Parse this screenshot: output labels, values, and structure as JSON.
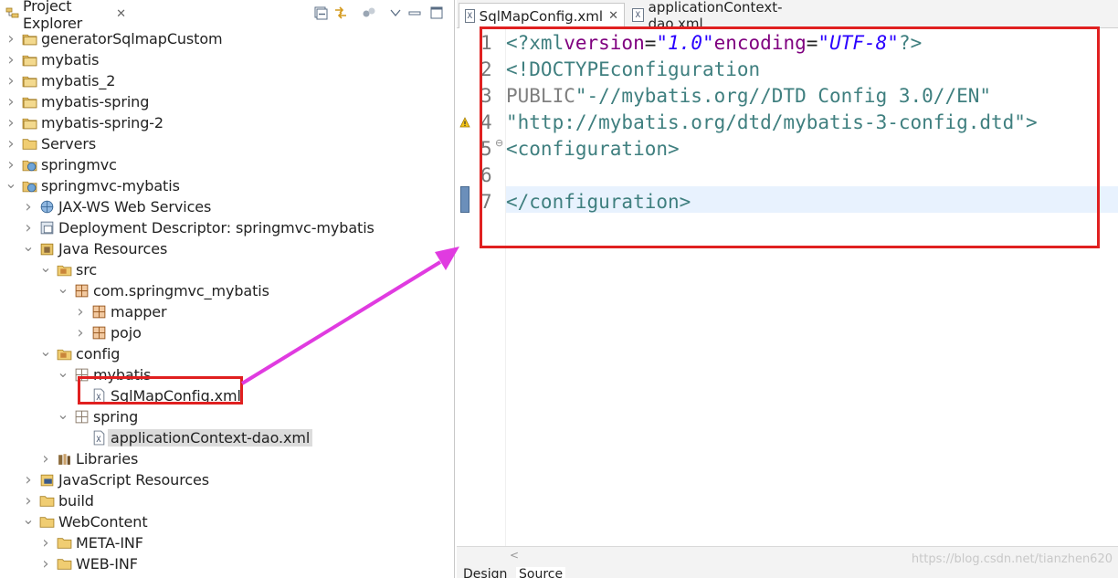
{
  "explorer": {
    "title": "Project Explorer",
    "close_icon": "close-icon",
    "toolbar": [
      "collapse-all-icon",
      "link-editor-icon",
      "focus-icon",
      "view-menu-icon",
      "minimize-icon",
      "maximize-icon"
    ]
  },
  "tree": [
    {
      "label": "generatorSqlmapCustom",
      "depth": 0,
      "chevron": "right",
      "icon": "project-icon"
    },
    {
      "label": "mybatis",
      "depth": 0,
      "chevron": "right",
      "icon": "project-icon"
    },
    {
      "label": "mybatis_2",
      "depth": 0,
      "chevron": "right",
      "icon": "project-icon"
    },
    {
      "label": "mybatis-spring",
      "depth": 0,
      "chevron": "right",
      "icon": "project-icon"
    },
    {
      "label": "mybatis-spring-2",
      "depth": 0,
      "chevron": "right",
      "icon": "project-icon"
    },
    {
      "label": "Servers",
      "depth": 0,
      "chevron": "right",
      "icon": "folder-icon"
    },
    {
      "label": "springmvc",
      "depth": 0,
      "chevron": "right",
      "icon": "web-project-icon"
    },
    {
      "label": "springmvc-mybatis",
      "depth": 0,
      "chevron": "down",
      "icon": "web-project-icon"
    },
    {
      "label": "JAX-WS Web Services",
      "depth": 1,
      "chevron": "right",
      "icon": "web-services-icon"
    },
    {
      "label": "Deployment Descriptor: springmvc-mybatis",
      "depth": 1,
      "chevron": "right",
      "icon": "descriptor-icon"
    },
    {
      "label": "Java Resources",
      "depth": 1,
      "chevron": "down",
      "icon": "java-resources-icon"
    },
    {
      "label": "src",
      "depth": 2,
      "chevron": "down",
      "icon": "source-folder-icon"
    },
    {
      "label": "com.springmvc_mybatis",
      "depth": 3,
      "chevron": "down",
      "icon": "package-icon"
    },
    {
      "label": "mapper",
      "depth": 4,
      "chevron": "right",
      "icon": "package-icon"
    },
    {
      "label": "pojo",
      "depth": 4,
      "chevron": "right",
      "icon": "package-icon"
    },
    {
      "label": "config",
      "depth": 2,
      "chevron": "down",
      "icon": "source-folder-icon"
    },
    {
      "label": "mybatis",
      "depth": 3,
      "chevron": "down",
      "icon": "package-empty-icon"
    },
    {
      "label": "SqlMapConfig.xml",
      "depth": 4,
      "chevron": "none",
      "icon": "xml-file-icon"
    },
    {
      "label": "spring",
      "depth": 3,
      "chevron": "down",
      "icon": "package-empty-icon"
    },
    {
      "label": "applicationContext-dao.xml",
      "depth": 4,
      "chevron": "none",
      "icon": "xml-file-icon",
      "selected": true
    },
    {
      "label": "Libraries",
      "depth": 2,
      "chevron": "right",
      "icon": "libraries-icon"
    },
    {
      "label": "JavaScript Resources",
      "depth": 1,
      "chevron": "right",
      "icon": "js-resources-icon"
    },
    {
      "label": "build",
      "depth": 1,
      "chevron": "right",
      "icon": "folder-icon"
    },
    {
      "label": "WebContent",
      "depth": 1,
      "chevron": "down",
      "icon": "folder-icon"
    },
    {
      "label": "META-INF",
      "depth": 2,
      "chevron": "right",
      "icon": "folder-icon"
    },
    {
      "label": "WEB-INF",
      "depth": 2,
      "chevron": "right",
      "icon": "folder-icon"
    }
  ],
  "editor": {
    "tabs": [
      {
        "label": "SqlMapConfig.xml",
        "active": true,
        "close": "✕"
      },
      {
        "label": "applicationContext-dao.xml",
        "active": false
      }
    ],
    "line_numbers": [
      "1",
      "2",
      "3",
      "4",
      "5",
      "6",
      "7"
    ],
    "code": {
      "l1": {
        "open": "<?xml",
        "attr1": "version",
        "eq1": "=",
        "val1": "\"1.0\"",
        "attr2": "encoding",
        "eq2": "=",
        "val2": "\"UTF-8\"",
        "close": "?>"
      },
      "l2": {
        "doctype": "<!DOCTYPE",
        "name": "configuration"
      },
      "l3": {
        "kw": "PUBLIC",
        "str": "\"-//mybatis.org//DTD Config 3.0//EN\""
      },
      "l4": {
        "str": "\"http://mybatis.org/dtd/mybatis-3-config.dtd\"",
        "close": ">"
      },
      "l5": {
        "tag": "<configuration>"
      },
      "l6": {
        "text": ""
      },
      "l7": {
        "tag": "</configuration>"
      }
    },
    "bottom_tabs": [
      "Design",
      "Source"
    ],
    "watermark": "https://blog.csdn.net/tianzhen620"
  },
  "colors": {
    "annotation_red": "#e02020",
    "arrow_magenta": "#e03be0"
  }
}
